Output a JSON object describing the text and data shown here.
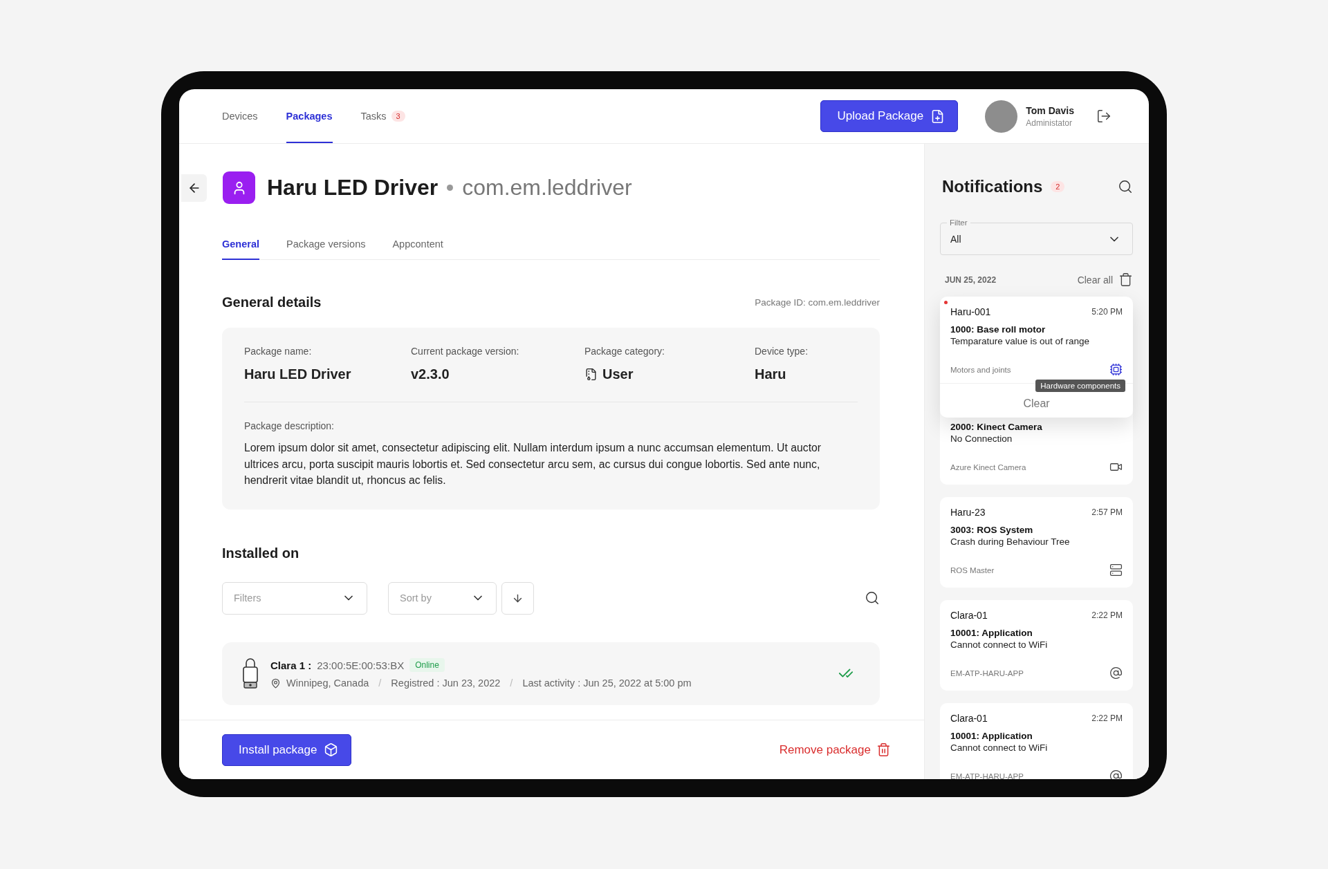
{
  "nav": {
    "tabs": [
      {
        "label": "Devices",
        "selected": false
      },
      {
        "label": "Packages",
        "selected": true
      },
      {
        "label": "Tasks",
        "selected": false,
        "badge": "3"
      }
    ],
    "upload_button": "Upload Package",
    "user": {
      "name": "Tom Davis",
      "role": "Administator"
    }
  },
  "package": {
    "title": "Haru LED Driver",
    "identifier": "com.em.leddriver",
    "tabs": [
      {
        "label": "General",
        "selected": true
      },
      {
        "label": "Package versions",
        "selected": false
      },
      {
        "label": "Appcontent",
        "selected": false
      }
    ],
    "details_title": "General details",
    "package_id": "Package ID: com.em.leddriver",
    "fields": [
      {
        "label": "Package name:",
        "value": "Haru LED Driver",
        "kind": "plain"
      },
      {
        "label": "Current package version:",
        "value": "v2.3.0",
        "kind": "plain"
      },
      {
        "label": "Package category:",
        "value": "User",
        "kind": "category"
      },
      {
        "label": "Device type:",
        "value": "Haru",
        "kind": "plain"
      }
    ],
    "description_label": "Package description:",
    "description": "Lorem ipsum dolor sit amet, consectetur adipiscing elit. Nullam interdum ipsum a nunc accumsan elementum. Ut auctor ultrices arcu, porta suscipit mauris lobortis et. Sed consectetur arcu sem, ac cursus dui congue lobortis. Sed ante nunc, hendrerit vitae blandit ut, rhoncus ac felis."
  },
  "installed": {
    "title": "Installed on",
    "filters": {
      "placeholder": "Filters"
    },
    "sort": {
      "placeholder": "Sort by"
    },
    "devices": [
      {
        "name": "Clara 1 :",
        "mac": "23:00:5E:00:53:BX",
        "status": "Online",
        "online": true,
        "location": "Winnipeg, Canada",
        "separator": "/",
        "registered": "Registred : Jun 23, 2022",
        "separator_2": "/",
        "activity": "Last activity : Jun 25, 2022 at 5:00 pm"
      }
    ]
  },
  "actions": {
    "install": "Install package",
    "remove": "Remove package"
  },
  "notifications": {
    "title": "Notifications",
    "badge": "2",
    "filter": {
      "label": "Filter",
      "value": "All"
    },
    "date": "JUN 25, 2022",
    "clear_all": "Clear all",
    "items": [
      {
        "kind": "hardware",
        "unread": true,
        "device": "Haru-001",
        "time": "5:20 PM",
        "code": "1000: Base roll motor",
        "message": "Temparature value is out of range",
        "source": "Motors and joints",
        "tooltip": "Hardware components",
        "clear_button": "Clear"
      },
      {
        "kind": "camera",
        "unread": false,
        "code": "2000: Kinect Camera",
        "message": "No Connection",
        "source": "Azure Kinect Camera"
      },
      {
        "kind": "server",
        "unread": false,
        "device": "Haru-23",
        "time": "2:57 PM",
        "code": "3003: ROS System",
        "message": "Crash during Behaviour Tree",
        "source": "ROS Master"
      },
      {
        "kind": "application",
        "unread": false,
        "device": "Clara-01",
        "time": "2:22 PM",
        "code": "10001: Application",
        "message": "Cannot connect to WiFi",
        "source": "EM-ATP-HARU-APP"
      },
      {
        "kind": "application",
        "unread": false,
        "device": "Clara-01",
        "time": "2:22 PM",
        "code": "10001: Application",
        "message": "Cannot connect to WiFi",
        "source": "EM-ATP-HARU-APP"
      }
    ]
  }
}
